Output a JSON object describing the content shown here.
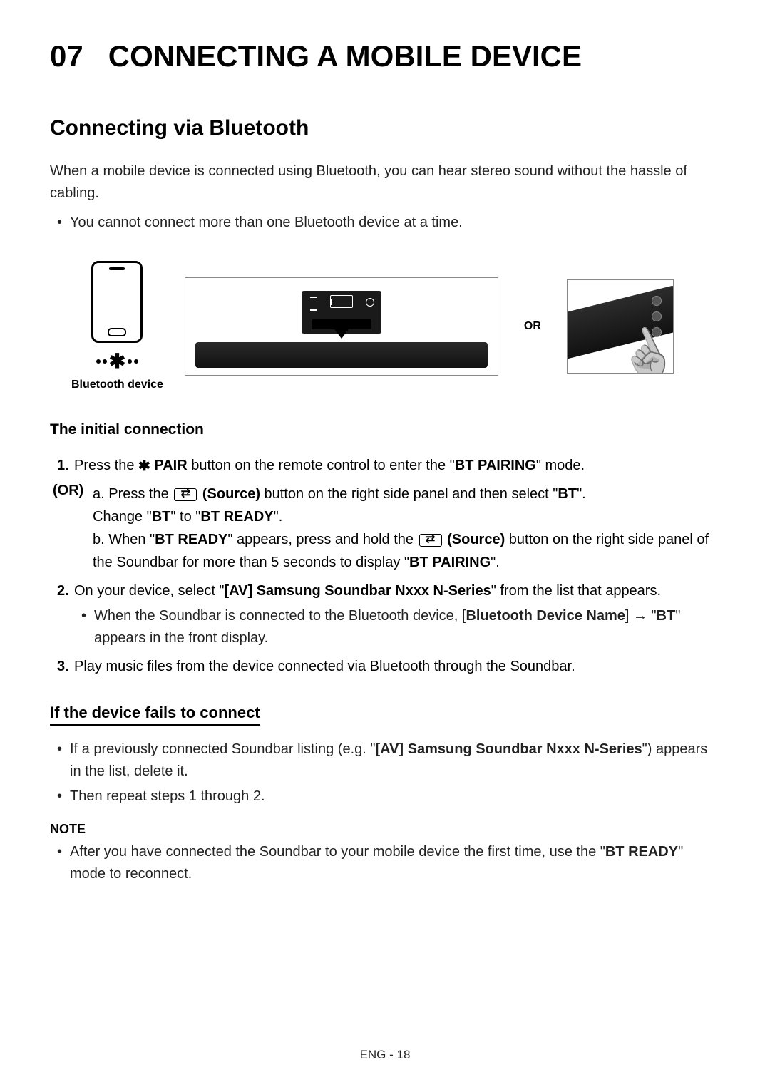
{
  "chapter": {
    "number": "07",
    "title": "CONNECTING A MOBILE DEVICE"
  },
  "section": {
    "title": "Connecting via Bluetooth",
    "intro": "When a mobile device is connected using Bluetooth, you can hear stereo sound without the hassle of cabling.",
    "intro_bullet": "You cannot connect more than one Bluetooth device at a time."
  },
  "diagram": {
    "bt_device_caption": "Bluetooth device",
    "or_label": "OR"
  },
  "initial": {
    "heading": "The initial connection",
    "step1_num": "1.",
    "step1_a": "Press the ",
    "step1_pair": " PAIR",
    "step1_b": " button on the remote control to enter the \"",
    "step1_mode": "BT PAIRING",
    "step1_c": "\" mode.",
    "or_tag": "(OR)",
    "or_a_letter": "a.",
    "or_a_1": "Press the ",
    "or_a_source": " (Source)",
    "or_a_2": " button on the right side panel and then select \"",
    "or_a_bt": "BT",
    "or_a_3": "\".",
    "or_a_line2_a": "Change \"",
    "or_a_line2_bt": "BT",
    "or_a_line2_b": "\" to \"",
    "or_a_line2_ready": "BT READY",
    "or_a_line2_c": "\".",
    "or_b_letter": "b.",
    "or_b_1": "When \"",
    "or_b_ready": "BT READY",
    "or_b_2": "\" appears, press and hold the ",
    "or_b_source": " (Source)",
    "or_b_3": " button on the right side panel of the Soundbar for more than 5 seconds to display \"",
    "or_b_pairing": "BT PAIRING",
    "or_b_4": "\".",
    "step2_num": "2.",
    "step2_a": "On your device, select \"",
    "step2_name": "[AV] Samsung Soundbar Nxxx N-Series",
    "step2_b": "\" from the list that appears.",
    "step2_bullet_a": "When the Soundbar is connected to the Bluetooth device, [",
    "step2_bullet_name": "Bluetooth Device Name",
    "step2_bullet_b": "] → \"",
    "step2_bullet_bt": "BT",
    "step2_bullet_c": "\" appears in the front display.",
    "step3_num": "3.",
    "step3_text": "Play music files from the device connected via Bluetooth through the Soundbar."
  },
  "fails": {
    "heading": "If the device fails to connect",
    "b1_a": "If a previously connected Soundbar listing (e.g. \"",
    "b1_name": "[AV] Samsung Soundbar Nxxx N-Series",
    "b1_b": "\") appears in the list, delete it.",
    "b2": "Then repeat steps 1 through 2."
  },
  "note": {
    "label": "NOTE",
    "b1_a": "After you have connected the Soundbar to your mobile device the first time, use the \"",
    "b1_ready": "BT READY",
    "b1_b": "\" mode to reconnect."
  },
  "footer": {
    "text": "ENG - 18"
  }
}
